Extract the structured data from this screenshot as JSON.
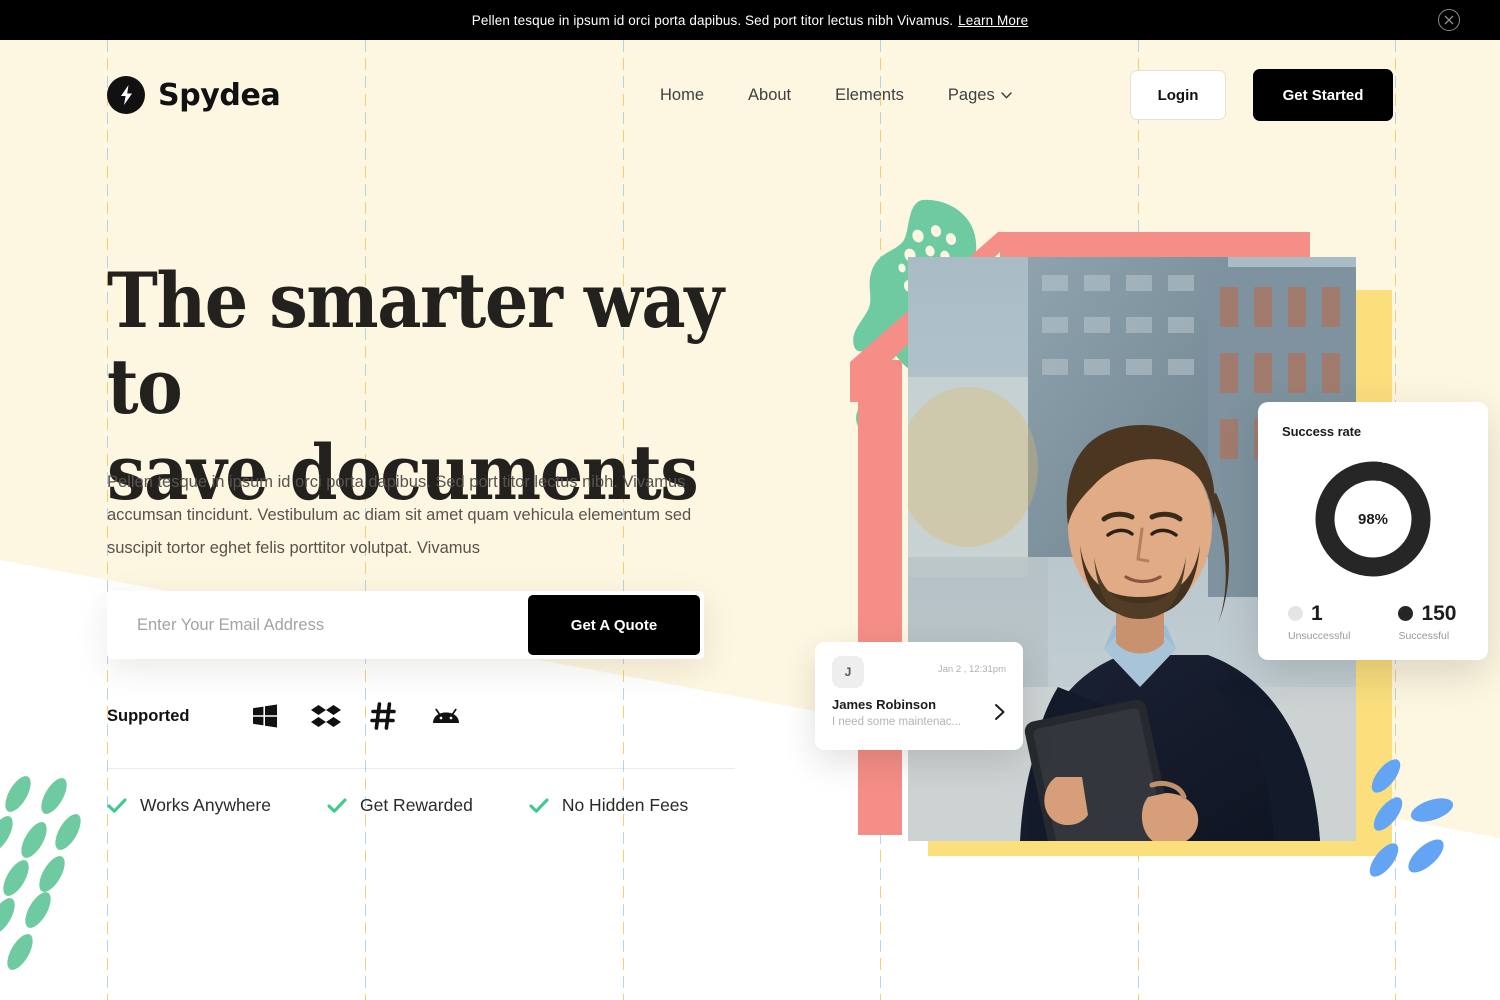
{
  "announce": {
    "text": "Pellen tesque in ipsum id orci porta dapibus. Sed port titor lectus nibh Vivamus.",
    "link_label": "Learn More",
    "close_icon": "close-circle-icon",
    "bg": "#000000"
  },
  "header": {
    "logo_icon": "lightning-bolt-icon",
    "brand": "Spydea",
    "nav": [
      {
        "label": "Home",
        "has_caret": false
      },
      {
        "label": "About",
        "has_caret": false
      },
      {
        "label": "Elements",
        "has_caret": false
      },
      {
        "label": "Pages",
        "has_caret": true,
        "caret": "⌄"
      }
    ],
    "login_label": "Login",
    "get_started_label": "Get Started"
  },
  "hero": {
    "title_line1": "The smarter way to",
    "title_line2": "save documents",
    "paragraph": "Pellen tesque in ipsum id orci porta dapibus. Sed port titor lectus nibh. Vivamus accumsan tincidunt. Vestibulum ac diam sit amet quam vehicula elementum sed suscipit tortor eghet felis porttitor volutpat. Vivamus",
    "email_placeholder": "Enter Your Email Address",
    "email_value": "",
    "quote_button": "Get A Quote",
    "supported_label": "Supported",
    "supported_icons": [
      {
        "name": "windows-icon"
      },
      {
        "name": "dropbox-icon"
      },
      {
        "name": "slack-hash-icon"
      },
      {
        "name": "android-icon"
      }
    ],
    "features": [
      {
        "label": "Works Anywhere",
        "icon": "check-icon"
      },
      {
        "label": "Get Rewarded",
        "icon": "check-icon"
      },
      {
        "label": "No Hidden Fees",
        "icon": "check-icon"
      }
    ]
  },
  "success_card": {
    "title": "Success rate",
    "center_value": "98%",
    "legend": [
      {
        "value": "1",
        "label": "Unsuccessful",
        "color": "#e5e5e5"
      },
      {
        "value": "150",
        "label": "Successful",
        "color": "#262626"
      }
    ]
  },
  "message_card": {
    "avatar_initial": "J",
    "timestamp": "Jan 2 , 12:31pm",
    "name": "James Robinson",
    "preview": "I need some maintenac...",
    "chevron_icon": "chevron-right-icon"
  },
  "chart_data": {
    "type": "pie",
    "title": "Success rate",
    "categories": [
      "Successful",
      "Unsuccessful"
    ],
    "values": [
      150,
      1
    ],
    "percentages": [
      98,
      2
    ],
    "colors": [
      "#262626",
      "#e5e5e5"
    ],
    "center_label": "98%",
    "legend": "bottom"
  },
  "theme": {
    "cream": "#fdf6e0",
    "pink": "#f58e86",
    "yellow": "#fbdf7d",
    "green": "#6ecaa0",
    "blue": "#63a4f5",
    "black": "#000000"
  }
}
